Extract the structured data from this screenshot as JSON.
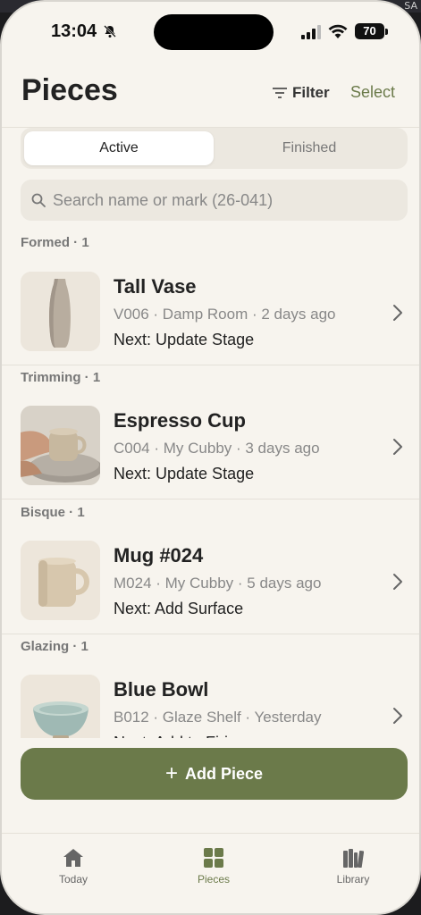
{
  "status_bar": {
    "time": "13:04",
    "battery": "70"
  },
  "browser_strip": {
    "text": "SA"
  },
  "header": {
    "title": "Pieces",
    "filter_label": "Filter",
    "select_label": "Select"
  },
  "segments": {
    "active": "Active",
    "finished": "Finished"
  },
  "search": {
    "placeholder": "Search name or mark (26-041)"
  },
  "sections": [
    {
      "header": "Formed · 1",
      "item": {
        "name": "Tall Vase",
        "meta": "V006 · Damp Room · 2 days ago",
        "next": "Next: Update Stage"
      }
    },
    {
      "header": "Trimming · 1",
      "item": {
        "name": "Espresso Cup",
        "meta": "C004 · My Cubby · 3 days ago",
        "next": "Next: Update Stage"
      }
    },
    {
      "header": "Bisque · 1",
      "item": {
        "name": "Mug #024",
        "meta": "M024 · My Cubby · 5 days ago",
        "next": "Next: Add Surface"
      }
    },
    {
      "header": "Glazing · 1",
      "item": {
        "name": "Blue Bowl",
        "meta": "B012 · Glaze Shelf · Yesterday",
        "next": "Next: Add to Firing"
      }
    }
  ],
  "add_button": {
    "label": "Add Piece"
  },
  "tabbar": {
    "today": "Today",
    "pieces": "Pieces",
    "library": "Library"
  },
  "colors": {
    "accent": "#6b7a4a",
    "background": "#f7f4ee",
    "muted_text": "#888888"
  },
  "icons": [
    "bell-slash-icon",
    "signal-icon",
    "wifi-icon",
    "battery-icon",
    "filter-icon",
    "search-icon",
    "chevron-right-icon",
    "plus-icon",
    "home-icon",
    "grid-icon",
    "books-icon"
  ]
}
